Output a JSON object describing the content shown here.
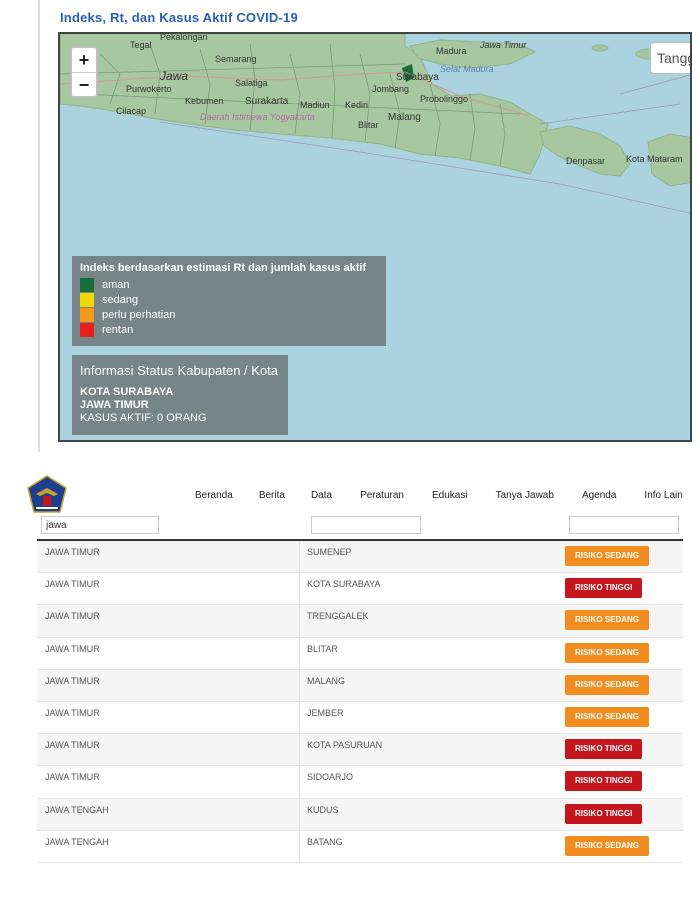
{
  "map": {
    "title": "Indeks, Rt, dan Kasus Aktif COVID-19",
    "zoom_in": "+",
    "zoom_out": "−",
    "date_control": "Tangg",
    "place_labels": [
      "Semarang",
      "Jawa",
      "Salatiga",
      "Purwokerto",
      "Kebumen",
      "Surakarta",
      "Madiun",
      "Kediri",
      "Surabaya",
      "Jombang",
      "Probolinggo",
      "Malang",
      "Blitar",
      "Madura",
      "Jawa Timur",
      "Selat Madura",
      "Cilacap",
      "Daerah Istimewa Yogyakarta",
      "Denpasar",
      "Kota Mataram",
      "Tegal",
      "Pekalongan"
    ],
    "legend": {
      "title": "Indeks berdasarkan estimasi Rt dan jumlah kasus aktif",
      "items": [
        {
          "label": "aman",
          "color": "#1a6b3a"
        },
        {
          "label": "sedang",
          "color": "#f2d600"
        },
        {
          "label": "perlu perhatian",
          "color": "#f29a1e"
        },
        {
          "label": "rentan",
          "color": "#e8221a"
        }
      ]
    },
    "info": {
      "title": "Informasi Status Kabupaten / Kota",
      "kota": "KOTA SURABAYA",
      "provinsi": "JAWA TIMUR",
      "kasus": "KASUS AKTIF: 0 ORANG"
    }
  },
  "nav": {
    "items": [
      "Beranda",
      "Berita",
      "Data",
      "Peraturan",
      "Edukasi",
      "Tanya Jawab",
      "Agenda",
      "Info Lain"
    ]
  },
  "filter": {
    "provinsi_value": "jawa",
    "kabupaten_value": "",
    "status_value": ""
  },
  "table": {
    "rows": [
      {
        "provinsi": "JAWA TIMUR",
        "kabupaten": "SUMENEP",
        "status": "RISIKO SEDANG"
      },
      {
        "provinsi": "JAWA TIMUR",
        "kabupaten": "KOTA SURABAYA",
        "status": "RISIKO TINGGI"
      },
      {
        "provinsi": "JAWA TIMUR",
        "kabupaten": "TRENGGALEK",
        "status": "RISIKO SEDANG"
      },
      {
        "provinsi": "JAWA TIMUR",
        "kabupaten": "BLITAR",
        "status": "RISIKO SEDANG"
      },
      {
        "provinsi": "JAWA TIMUR",
        "kabupaten": "MALANG",
        "status": "RISIKO SEDANG"
      },
      {
        "provinsi": "JAWA TIMUR",
        "kabupaten": "JEMBER",
        "status": "RISIKO SEDANG"
      },
      {
        "provinsi": "JAWA TIMUR",
        "kabupaten": "KOTA PASURUAN",
        "status": "RISIKO TINGGI"
      },
      {
        "provinsi": "JAWA TIMUR",
        "kabupaten": "SIDOARJO",
        "status": "RISIKO TINGGI"
      },
      {
        "provinsi": "JAWA TENGAH",
        "kabupaten": "KUDUS",
        "status": "RISIKO TINGGI"
      },
      {
        "provinsi": "JAWA TENGAH",
        "kabupaten": "BATANG",
        "status": "RISIKO SEDANG"
      }
    ]
  },
  "colors": {
    "title_blue": "#2a5fb8",
    "sea": "#aad3df",
    "land": "#a7c7a0",
    "risiko_sedang": "#f28c1e",
    "risiko_tinggi": "#c5161d"
  }
}
